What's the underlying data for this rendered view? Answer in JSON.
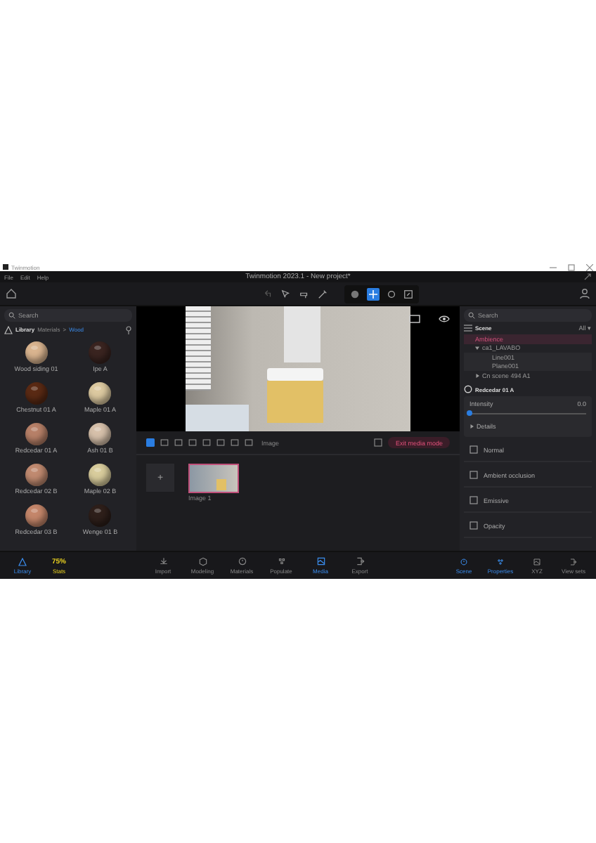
{
  "os_window": {
    "title": "Twinmotion"
  },
  "menu": [
    "File",
    "Edit",
    "Help"
  ],
  "window_title": "Twinmotion 2023.1 - New project*",
  "library": {
    "search": {
      "placeholder": "Search"
    },
    "title": "Library",
    "breadcrumb": [
      "Materials",
      "Wood"
    ],
    "separator": ">",
    "materials": [
      {
        "name": "Wood siding 01",
        "color": "#d9b48f"
      },
      {
        "name": "Ipe A",
        "color": "#3a2420"
      },
      {
        "name": "Chestnut 01 A",
        "color": "#5a2a14"
      },
      {
        "name": "Maple 01 A",
        "color": "#dcc9a0"
      },
      {
        "name": "Redcedar 01 A",
        "color": "#b78068"
      },
      {
        "name": "Ash 01 B",
        "color": "#d6c0aa"
      },
      {
        "name": "Redcedar 02 B",
        "color": "#c08a70"
      },
      {
        "name": "Maple 02 B",
        "color": "#d8cc9c"
      },
      {
        "name": "Redcedar 03 B",
        "color": "#c4866a"
      },
      {
        "name": "Wenge 01 B",
        "color": "#2e1f1a"
      }
    ]
  },
  "media": {
    "toolbar_label": "Image",
    "exit_button": "Exit media mode",
    "add_button": "+",
    "thumbnails": [
      {
        "label": "Image 1",
        "selected": true
      }
    ]
  },
  "scene": {
    "search": {
      "placeholder": "Search"
    },
    "title": "Scene",
    "filter": "All ▾",
    "tree": [
      {
        "label": "Ambience",
        "selected": true
      },
      {
        "label": "ca1_LAVABO",
        "selected": false,
        "expanded": true,
        "children": [
          {
            "label": "Line001",
            "selected": false
          },
          {
            "label": "Plane001",
            "selected": false
          }
        ]
      },
      {
        "label": "Cn scene 494 A1",
        "selected": false,
        "expanded": false
      }
    ]
  },
  "properties": {
    "material": "Redcedar 01 A",
    "intensity": {
      "label": "Intensity",
      "reading": "0.0",
      "level": 0
    },
    "details": "Details",
    "sections": [
      "Normal",
      "Ambient occlusion",
      "Emissive",
      "Opacity"
    ]
  },
  "bottom_left": [
    {
      "label": "Library",
      "selected": true
    },
    {
      "label": "Stats",
      "selected": false,
      "badge": "75%"
    }
  ],
  "bottom_center": [
    {
      "label": "Import",
      "selected": false
    },
    {
      "label": "Modeling",
      "selected": false
    },
    {
      "label": "Materials",
      "selected": false
    },
    {
      "label": "Populate",
      "selected": false
    },
    {
      "label": "Media",
      "selected": true
    },
    {
      "label": "Export",
      "selected": false
    }
  ],
  "bottom_right": [
    {
      "label": "Scene",
      "selected": true
    },
    {
      "label": "Properties",
      "selected": true
    },
    {
      "label": "XYZ",
      "selected": false
    },
    {
      "label": "View sets",
      "selected": false
    }
  ]
}
